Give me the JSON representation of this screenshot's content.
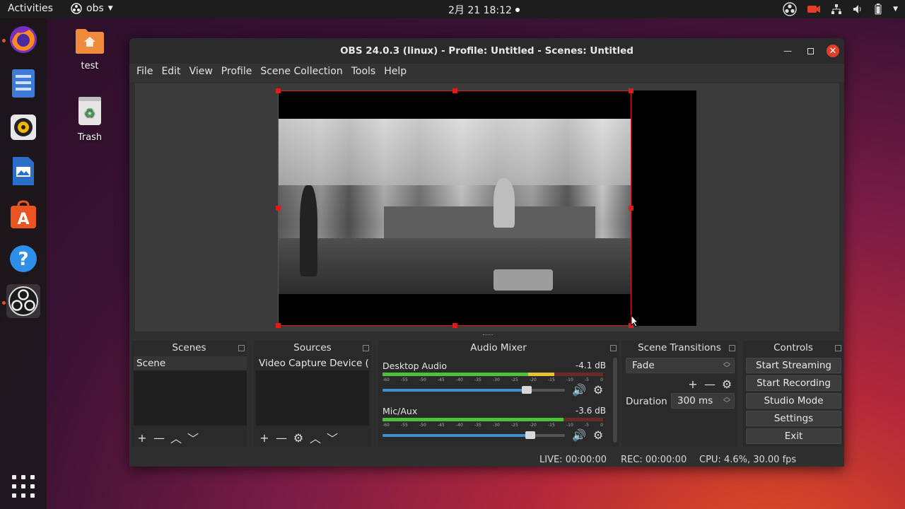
{
  "topbar": {
    "activities": "Activities",
    "app_name": "obs",
    "clock": "2月 21  18:12"
  },
  "dock": {
    "items": [
      "firefox-icon",
      "files-icon",
      "rhythmbox-icon",
      "libreoffice-writer-icon",
      "software-center-icon",
      "help-icon",
      "obs-icon"
    ],
    "active": "obs-icon"
  },
  "desktop": {
    "icons": [
      {
        "label": "test"
      },
      {
        "label": "Trash"
      }
    ]
  },
  "window": {
    "title": "OBS 24.0.3 (linux) - Profile: Untitled - Scenes: Untitled",
    "menu": [
      "File",
      "Edit",
      "View",
      "Profile",
      "Scene Collection",
      "Tools",
      "Help"
    ]
  },
  "scenes": {
    "title": "Scenes",
    "items": [
      "Scene"
    ]
  },
  "sources": {
    "title": "Sources",
    "items": [
      "Video Capture Device (V"
    ]
  },
  "mixer": {
    "title": "Audio Mixer",
    "tracks": [
      {
        "name": "Desktop Audio",
        "db": "-4.1 dB",
        "volume": 0.79
      },
      {
        "name": "Mic/Aux",
        "db": "-3.6 dB",
        "volume": 0.81
      }
    ],
    "ticks": [
      "-60",
      "-55",
      "-50",
      "-45",
      "-40",
      "-35",
      "-30",
      "-25",
      "-20",
      "-15",
      "-10",
      "-5",
      "0"
    ]
  },
  "transitions": {
    "title": "Scene Transitions",
    "selected": "Fade",
    "duration_label": "Duration",
    "duration_value": "300 ms"
  },
  "controls": {
    "title": "Controls",
    "buttons": [
      "Start Streaming",
      "Start Recording",
      "Studio Mode",
      "Settings",
      "Exit"
    ]
  },
  "status": {
    "live": "LIVE: 00:00:00",
    "rec": "REC: 00:00:00",
    "cpu": "CPU: 4.6%, 30.00 fps"
  },
  "colors": {
    "accent": "#e95420",
    "selection": "#e01a1a",
    "slider": "#3d8fd6"
  }
}
